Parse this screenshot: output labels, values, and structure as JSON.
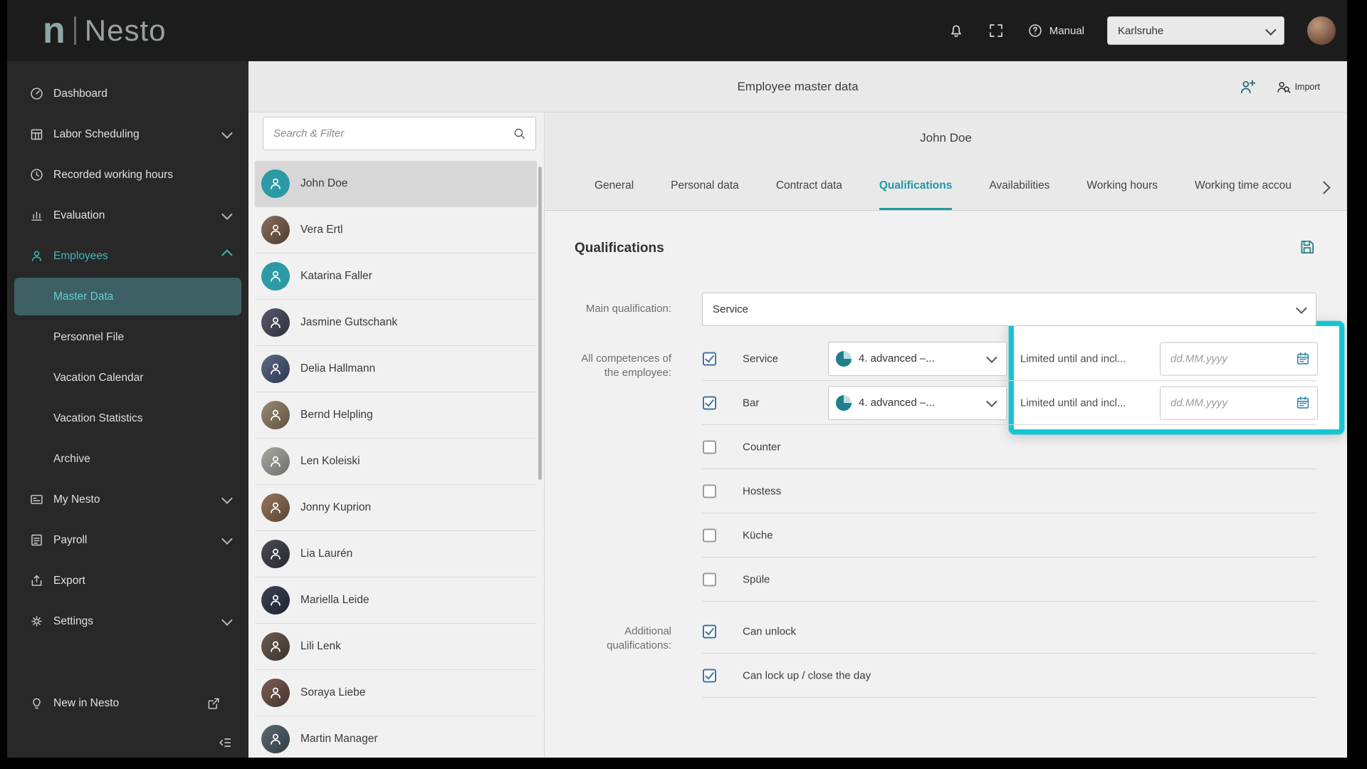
{
  "topbar": {
    "brand_initial": "n",
    "brand_name": "Nesto",
    "manual_label": "Manual",
    "location_value": "Karlsruhe"
  },
  "sidebar": {
    "dashboard": "Dashboard",
    "labor_scheduling": "Labor Scheduling",
    "recorded_hours": "Recorded working hours",
    "evaluation": "Evaluation",
    "employees": "Employees",
    "master_data": "Master Data",
    "personnel_file": "Personnel File",
    "vacation_calendar": "Vacation Calendar",
    "vacation_statistics": "Vacation Statistics",
    "archive": "Archive",
    "my_nesto": "My Nesto",
    "payroll": "Payroll",
    "export": "Export",
    "settings": "Settings",
    "new_in_nesto": "New in Nesto"
  },
  "header": {
    "title": "Employee master data",
    "import_label": "Import"
  },
  "search": {
    "placeholder": "Search & Filter"
  },
  "employees": [
    {
      "name": "John Doe"
    },
    {
      "name": "Vera Ertl"
    },
    {
      "name": "Katarina Faller"
    },
    {
      "name": "Jasmine Gutschank"
    },
    {
      "name": "Delia Hallmann"
    },
    {
      "name": "Bernd Helpling"
    },
    {
      "name": "Len Koleiski"
    },
    {
      "name": "Jonny Kuprion"
    },
    {
      "name": "Lia Laurén"
    },
    {
      "name": "Mariella Leide"
    },
    {
      "name": "Lili Lenk"
    },
    {
      "name": "Soraya Liebe"
    },
    {
      "name": "Martin Manager"
    }
  ],
  "detail": {
    "title": "John Doe",
    "tabs": [
      "General",
      "Personal data",
      "Contract data",
      "Qualifications",
      "Availabilities",
      "Working hours",
      "Working time accou"
    ],
    "section_title": "Qualifications",
    "main_qualification_label": "Main qualification:",
    "main_qualification_value": "Service",
    "competences_label": "All competences of the employee:",
    "additional_label": "Additional qualifications:",
    "level_value": "4. advanced –...",
    "limited_label": "Limited until and incl...",
    "date_placeholder": "dd.MM.yyyy",
    "competences": [
      {
        "label": "Service",
        "checked": true
      },
      {
        "label": "Bar",
        "checked": true
      },
      {
        "label": "Counter",
        "checked": false
      },
      {
        "label": "Hostess",
        "checked": false
      },
      {
        "label": "Küche",
        "checked": false
      },
      {
        "label": "Spüle",
        "checked": false
      }
    ],
    "additional": [
      {
        "label": "Can unlock",
        "checked": true
      },
      {
        "label": "Can lock up / close the day",
        "checked": true
      }
    ]
  },
  "colors": {
    "accent_teal": "#1d9ba3",
    "highlight": "#15c5d3",
    "checkbox_blue": "#44719f"
  }
}
